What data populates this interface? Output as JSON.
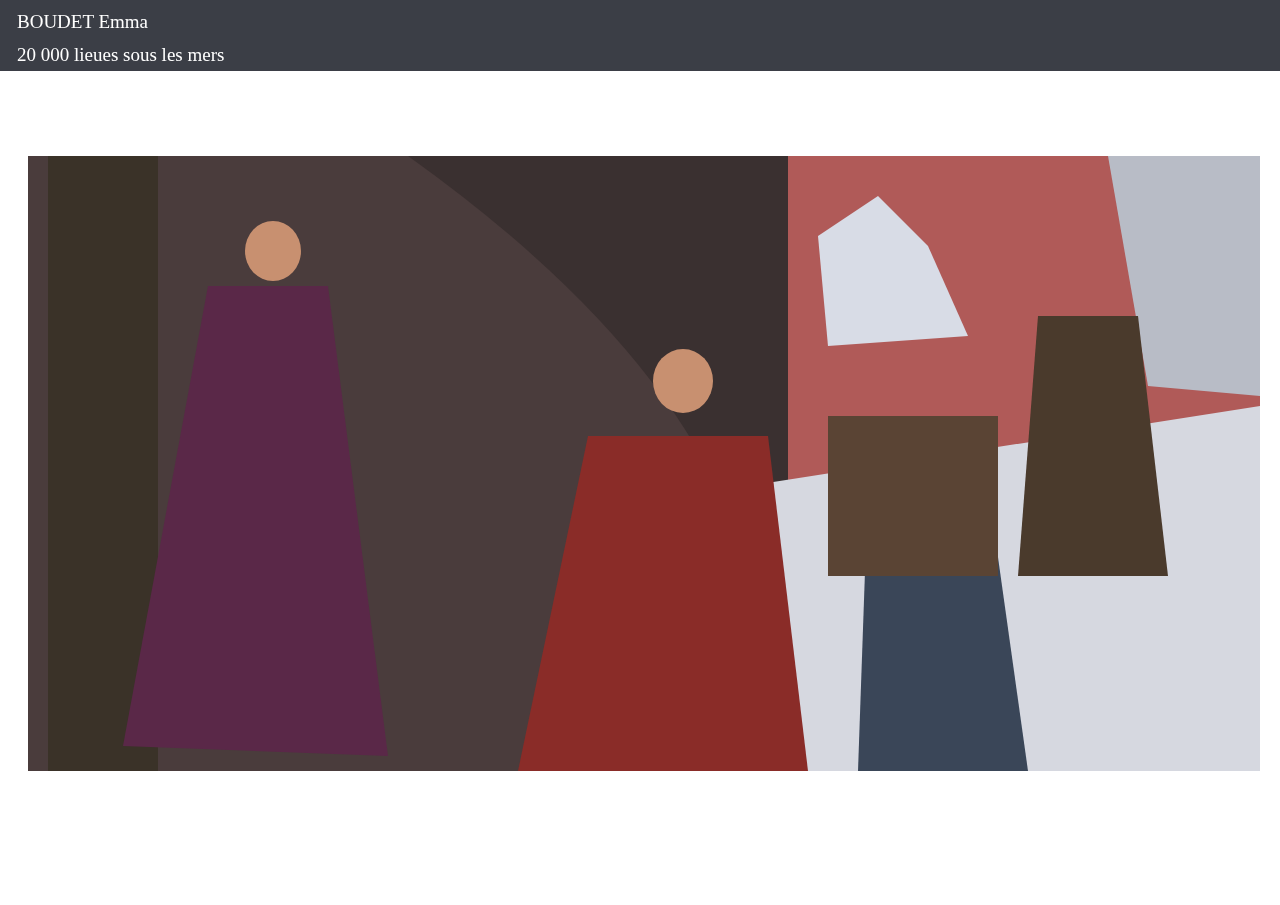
{
  "header": {
    "author": "BOUDET Emma",
    "title": "20 000 lieues sous les mers"
  }
}
